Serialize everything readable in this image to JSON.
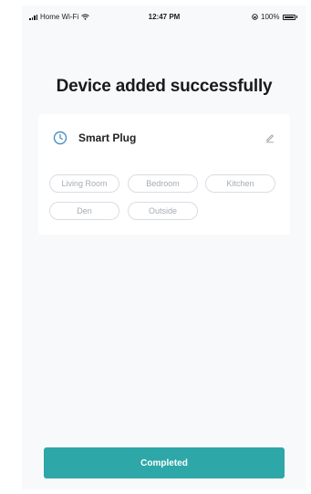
{
  "status_bar": {
    "carrier": "Home Wi-Fi",
    "time": "12:47 PM",
    "battery": "100%"
  },
  "page": {
    "title": "Device added successfully"
  },
  "device": {
    "name": "Smart Plug",
    "icon": "clock-icon"
  },
  "rooms": [
    {
      "label": "Living Room"
    },
    {
      "label": "Bedroom"
    },
    {
      "label": "Kitchen"
    },
    {
      "label": "Den"
    },
    {
      "label": "Outside"
    }
  ],
  "actions": {
    "completed_label": "Completed"
  },
  "colors": {
    "accent": "#2ea7a8",
    "background": "#f8f9fa",
    "chip_border": "#d9dde2",
    "chip_text": "#a7acb3"
  }
}
